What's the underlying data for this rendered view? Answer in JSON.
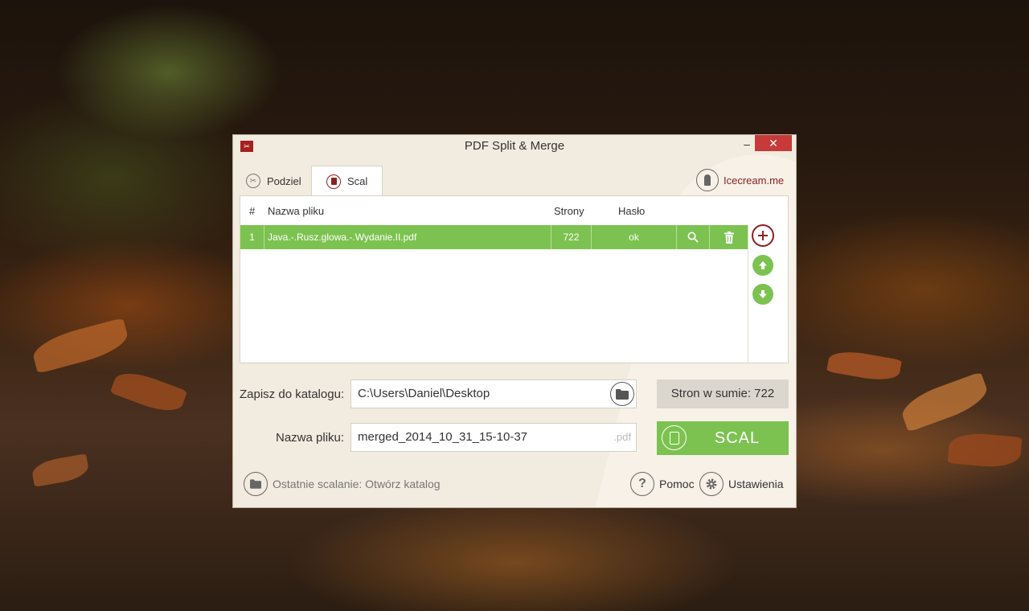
{
  "window": {
    "title": "PDF Split & Merge",
    "app_icon": "pdf-app-icon",
    "minimize_label": "–",
    "close_label": "✕"
  },
  "tabs": [
    {
      "label": "Podziel",
      "icon": "scissors-icon",
      "active": false
    },
    {
      "label": "Scal",
      "icon": "merge-document-icon",
      "active": true
    }
  ],
  "brand": {
    "label": "Icecream.me",
    "icon": "icecream-icon"
  },
  "table": {
    "columns": [
      "#",
      "Nazwa pliku",
      "Strony",
      "Hasło"
    ],
    "rows": [
      {
        "num": "1",
        "name": "Java.-.Rusz.glowa.-.Wydanie.II.pdf",
        "pages": "722",
        "password": "ok"
      }
    ],
    "row_color": "#7cc250"
  },
  "side_buttons": {
    "add_icon": "plus-icon",
    "up_icon": "arrow-up-icon",
    "down_icon": "arrow-down-icon"
  },
  "output": {
    "dir_label": "Zapisz do katalogu:",
    "dir_value": "C:\\Users\\Daniel\\Desktop",
    "name_label": "Nazwa pliku:",
    "name_value": "merged_2014_10_31_15-10-37",
    "ext": ".pdf"
  },
  "summary": {
    "total_pages_label": "Stron w sumie: 722"
  },
  "action": {
    "merge_label": "SCAL"
  },
  "footer": {
    "last_merge_label": "Ostatnie scalanie: Otwórz katalog",
    "help_label": "Pomoc",
    "settings_label": "Ustawienia"
  },
  "colors": {
    "accent_green": "#7cc250",
    "brand_red": "#8c2020",
    "close_red": "#c8393a"
  }
}
